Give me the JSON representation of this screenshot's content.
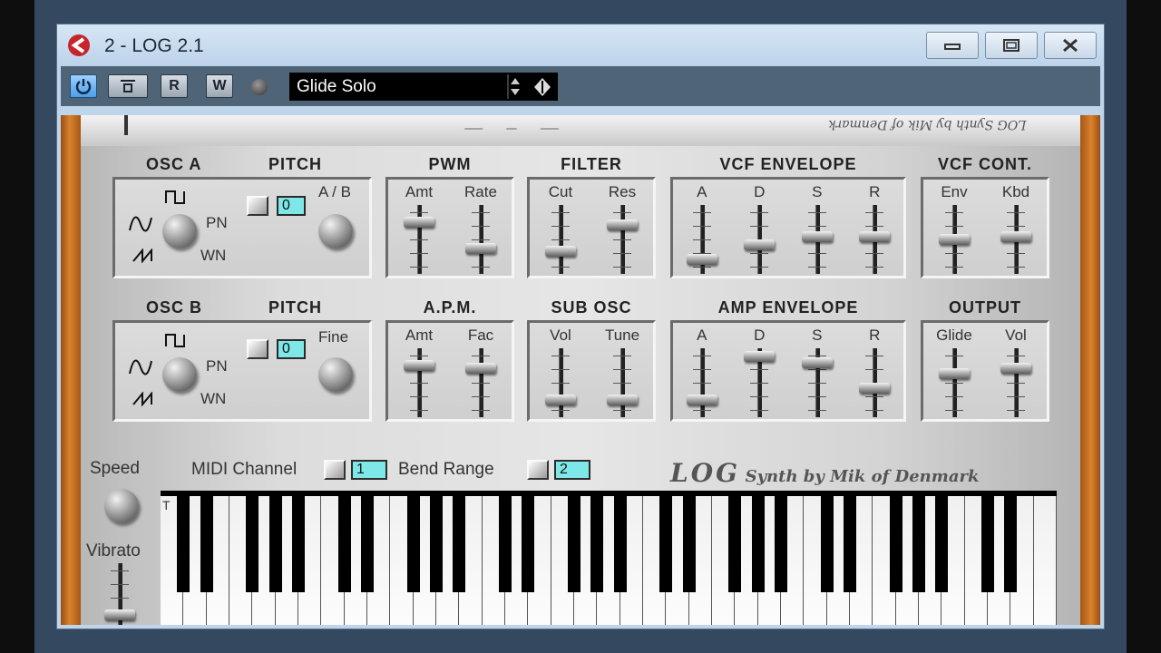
{
  "window": {
    "title": "2 - LOG 2.1"
  },
  "toolbar": {
    "read_label": "R",
    "write_label": "W",
    "preset_name": "Glide Solo"
  },
  "top_strip": {
    "text": "LOG Synth by Mik of Denmark"
  },
  "sections": {
    "osc_a": {
      "title": "OSC A",
      "pitch": "PITCH",
      "knob_label": "A / B",
      "pitch_value": "0",
      "pn": "PN",
      "wn": "WN"
    },
    "osc_b": {
      "title": "OSC B",
      "pitch": "PITCH",
      "knob_label": "Fine",
      "pitch_value": "0",
      "pn": "PN",
      "wn": "WN"
    },
    "pwm": {
      "title": "PWM",
      "labels": [
        "Amt",
        "Rate"
      ],
      "values": [
        0.8,
        0.35
      ]
    },
    "filter": {
      "title": "FILTER",
      "labels": [
        "Cut",
        "Res"
      ],
      "values": [
        0.3,
        0.75
      ]
    },
    "vcf_env": {
      "title": "VCF ENVELOPE",
      "labels": [
        "A",
        "D",
        "S",
        "R"
      ],
      "values": [
        0.15,
        0.4,
        0.55,
        0.55
      ]
    },
    "vcf_cont": {
      "title": "VCF CONT.",
      "labels": [
        "Env",
        "Kbd"
      ],
      "values": [
        0.5,
        0.55
      ]
    },
    "apm": {
      "title": "A.P.M.",
      "labels": [
        "Amt",
        "Fac"
      ],
      "values": [
        0.8,
        0.75
      ]
    },
    "sub_osc": {
      "title": "SUB OSC",
      "labels": [
        "Vol",
        "Tune"
      ],
      "values": [
        0.2,
        0.2
      ]
    },
    "amp_env": {
      "title": "AMP ENVELOPE",
      "labels": [
        "A",
        "D",
        "S",
        "R"
      ],
      "values": [
        0.2,
        0.95,
        0.85,
        0.4
      ]
    },
    "output": {
      "title": "OUTPUT",
      "labels": [
        "Glide",
        "Vol"
      ],
      "values": [
        0.65,
        0.75
      ]
    }
  },
  "bottom": {
    "speed": "Speed",
    "vibrato": "Vibrato",
    "vibrato_value": 0.2,
    "midi_channel_label": "MIDI Channel",
    "midi_channel_value": "1",
    "bend_range_label": "Bend Range",
    "bend_range_value": "2",
    "credit_logo": "LOG",
    "credit_text": "Synth by Mik of Denmark"
  },
  "keyboard": {
    "active_key_marker": "T",
    "white_keys": 39
  }
}
